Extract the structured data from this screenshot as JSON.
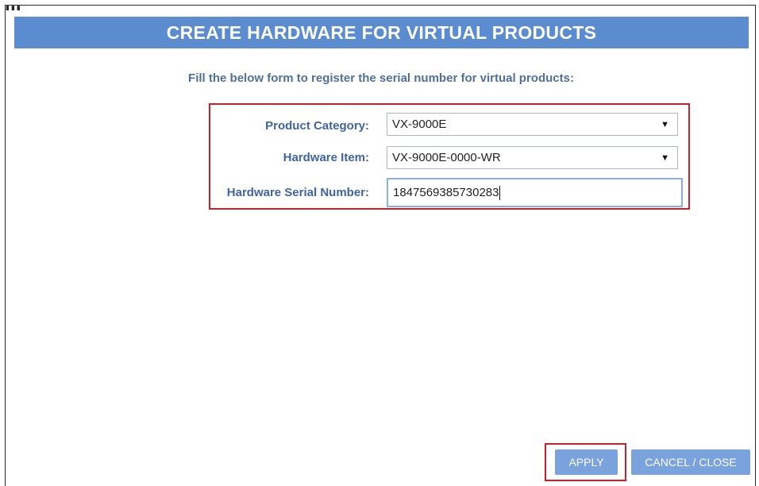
{
  "dialog": {
    "title": "CREATE HARDWARE FOR VIRTUAL PRODUCTS",
    "instruction": "Fill the below form to register the serial number for virtual products:"
  },
  "form": {
    "product_category": {
      "label": "Product Category:",
      "value": "VX-9000E"
    },
    "hardware_item": {
      "label": "Hardware Item:",
      "value": "VX-9000E-0000-WR"
    },
    "hardware_serial_number": {
      "label": "Hardware Serial Number:",
      "value": "1847569385730283"
    }
  },
  "buttons": {
    "apply": "APPLY",
    "cancel_close": "CANCEL / CLOSE"
  },
  "icons": {
    "dropdown": "chevron-down-icon",
    "window_corner": "window-icon"
  },
  "colors": {
    "header": "#5b8ccf",
    "label_text": "#3e63a8",
    "highlight": "#cc1f2c",
    "button": "#7aa2dc"
  }
}
